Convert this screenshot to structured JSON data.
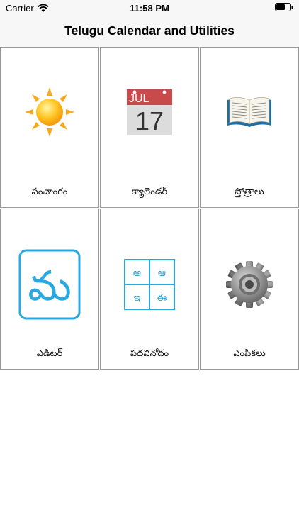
{
  "status_bar": {
    "carrier": "Carrier",
    "time": "11:58 PM"
  },
  "nav": {
    "title": "Telugu Calendar and Utilities"
  },
  "tiles": [
    {
      "label": "పంచాంగం",
      "icon": "sun-icon"
    },
    {
      "label": "క్యాలెండర్",
      "icon": "calendar-icon",
      "icon_month": "JUL",
      "icon_day": "17"
    },
    {
      "label": "స్తోత్రాలు",
      "icon": "book-icon"
    },
    {
      "label": "ఎడిటర్",
      "icon": "telugu-letter-icon",
      "icon_glyph": "మ"
    },
    {
      "label": "పదవినోదం",
      "icon": "word-puzzle-icon",
      "icon_glyphs": [
        "అ",
        "ఆ",
        "ఇ",
        "ఈ"
      ]
    },
    {
      "label": "ఎంపికలు",
      "icon": "gear-icon"
    }
  ],
  "colors": {
    "accent_blue": "#2AA8E0",
    "calendar_red": "#C94A4A",
    "bar_bg": "#F7F7F7"
  }
}
